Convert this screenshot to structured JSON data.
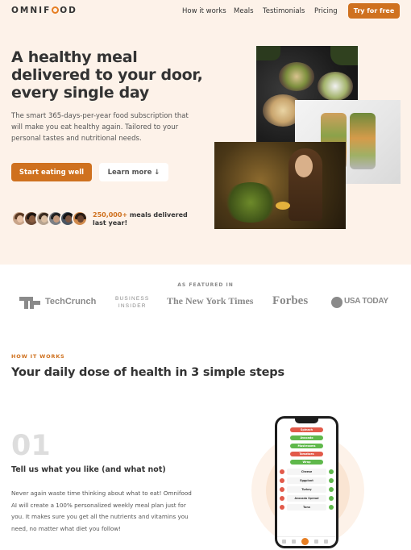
{
  "header": {
    "logo_pre": "OMNIF",
    "logo_post": "OD",
    "nav": [
      "How it works",
      "Meals",
      "Testimonials",
      "Pricing"
    ],
    "cta": "Try for free"
  },
  "hero": {
    "title": "A healthy meal delivered to your door, every single day",
    "description": "The smart 365-days-per-year food subscription that will make you eat healthy again. Tailored to your personal tastes and nutritional needs.",
    "primary_button": "Start eating well",
    "secondary_button": "Learn more ↓",
    "delivered_count": "250,000+",
    "delivered_text": " meals delivered last year!"
  },
  "featured": {
    "label": "AS FEATURED IN",
    "logos": [
      "TechCrunch",
      "BUSINESS",
      "INSIDER",
      "The New York Times",
      "Forbes",
      "USA TODAY"
    ]
  },
  "how_it_works": {
    "label": "HOW IT WORKS",
    "title": "Your daily dose of health in 3 simple steps",
    "step_number": "01",
    "step_title": "Tell us what you like (and what not)",
    "step_description": "Never again waste time thinking about what to eat! Omnifood AI will create a 100% personalized weekly meal plan just for you. It makes sure you get all the nutrients and vitamins you need, no matter what diet you follow!"
  },
  "phone": {
    "tags": [
      "Spinach",
      "Avocado",
      "Mushrooms",
      "Tomatoes",
      "Wrap"
    ],
    "foods": [
      "Cheese",
      "Eggplant",
      "Turkey",
      "Avocado Spread",
      "Tuna"
    ]
  },
  "colors": {
    "accent": "#cf711f",
    "hero_bg": "#fdf2e9"
  }
}
